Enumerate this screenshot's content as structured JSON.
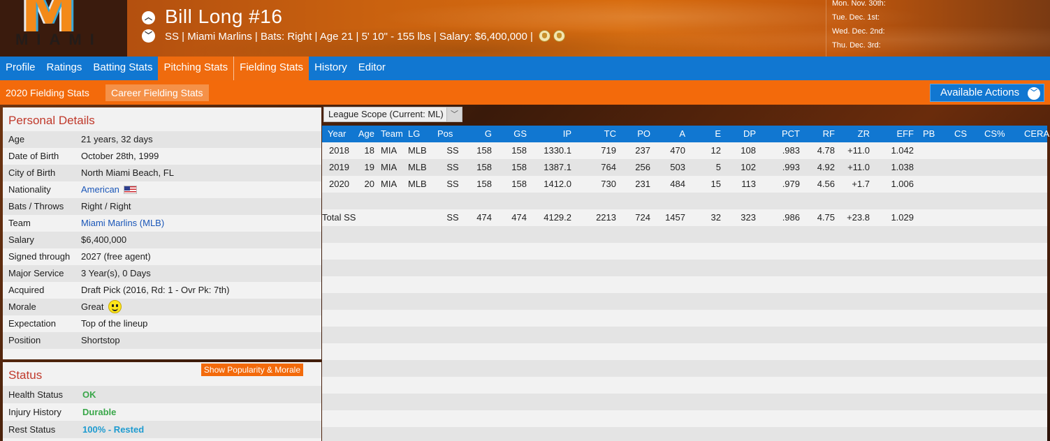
{
  "header": {
    "logo_text": "MIAMI",
    "player_name": "Bill Long  #16",
    "position": "SS",
    "team": "Miami Marlins",
    "bats": "Bats: Right",
    "age": "Age 21",
    "height_weight": "5' 10\" - 155 lbs",
    "salary": "Salary: $6,400,000",
    "schedule": [
      "Mon. Nov. 30th:",
      "Tue. Dec. 1st:",
      "Wed. Dec. 2nd:",
      "Thu. Dec. 3rd:"
    ]
  },
  "tabs": [
    {
      "label": "Profile",
      "active": false
    },
    {
      "label": "Ratings",
      "active": false
    },
    {
      "label": "Batting Stats",
      "active": false
    },
    {
      "label": "Pitching Stats",
      "active": true
    },
    {
      "label": "Fielding Stats",
      "active": true
    },
    {
      "label": "History",
      "active": false
    },
    {
      "label": "Editor",
      "active": false
    }
  ],
  "subtabs": {
    "current": "2020 Fielding Stats",
    "career": "Career Fielding Stats",
    "actions": "Available Actions"
  },
  "personal": {
    "title": "Personal Details",
    "rows": [
      {
        "k": "Age",
        "v": "21 years, 32 days"
      },
      {
        "k": "Date of Birth",
        "v": "October 28th, 1999"
      },
      {
        "k": "City of Birth",
        "v": "North Miami Beach, FL"
      },
      {
        "k": "Nationality",
        "v": "American"
      },
      {
        "k": "Bats / Throws",
        "v": "Right / Right"
      },
      {
        "k": "Team",
        "v": "Miami Marlins (MLB)"
      },
      {
        "k": "Salary",
        "v": "$6,400,000"
      },
      {
        "k": "Signed through",
        "v": "2027 (free agent)"
      },
      {
        "k": "Major Service",
        "v": "3 Year(s), 0 Days"
      },
      {
        "k": "Acquired",
        "v": "Draft Pick (2016, Rd: 1 - Ovr Pk: 7th)"
      },
      {
        "k": "Morale",
        "v": "Great"
      },
      {
        "k": "Expectation",
        "v": "Top of the lineup"
      },
      {
        "k": "Position",
        "v": "Shortstop"
      }
    ]
  },
  "status": {
    "title": "Status",
    "button": "Show Popularity & Morale",
    "health_label": "Health Status",
    "health": "OK",
    "injury_label": "Injury History",
    "injury": "Durable",
    "rest_label": "Rest Status",
    "rest": "100% - Rested"
  },
  "scope": {
    "label": "League Scope  (Current: ML)"
  },
  "grid": {
    "columns": [
      "Year",
      "Age",
      "Team",
      "LG",
      "Pos",
      "G",
      "GS",
      "IP",
      "TC",
      "PO",
      "A",
      "E",
      "DP",
      "PCT",
      "RF",
      "ZR",
      "EFF",
      "PB",
      "CS",
      "CS%",
      "CERA"
    ],
    "rows": [
      [
        "2018",
        "18",
        "MIA",
        "MLB",
        "SS",
        "158",
        "158",
        "1330.1",
        "719",
        "237",
        "470",
        "12",
        "108",
        ".983",
        "4.78",
        "+11.0",
        "1.042",
        "",
        "",
        "",
        ""
      ],
      [
        "2019",
        "19",
        "MIA",
        "MLB",
        "SS",
        "158",
        "158",
        "1387.1",
        "764",
        "256",
        "503",
        "5",
        "102",
        ".993",
        "4.92",
        "+11.0",
        "1.038",
        "",
        "",
        "",
        ""
      ],
      [
        "2020",
        "20",
        "MIA",
        "MLB",
        "SS",
        "158",
        "158",
        "1412.0",
        "730",
        "231",
        "484",
        "15",
        "113",
        ".979",
        "4.56",
        "+1.7",
        "1.006",
        "",
        "",
        "",
        ""
      ]
    ],
    "total": [
      "Total SS",
      "",
      "",
      "",
      "SS",
      "474",
      "474",
      "4129.2",
      "2213",
      "724",
      "1457",
      "32",
      "323",
      ".986",
      "4.75",
      "+23.8",
      "1.029",
      "",
      "",
      "",
      ""
    ]
  }
}
